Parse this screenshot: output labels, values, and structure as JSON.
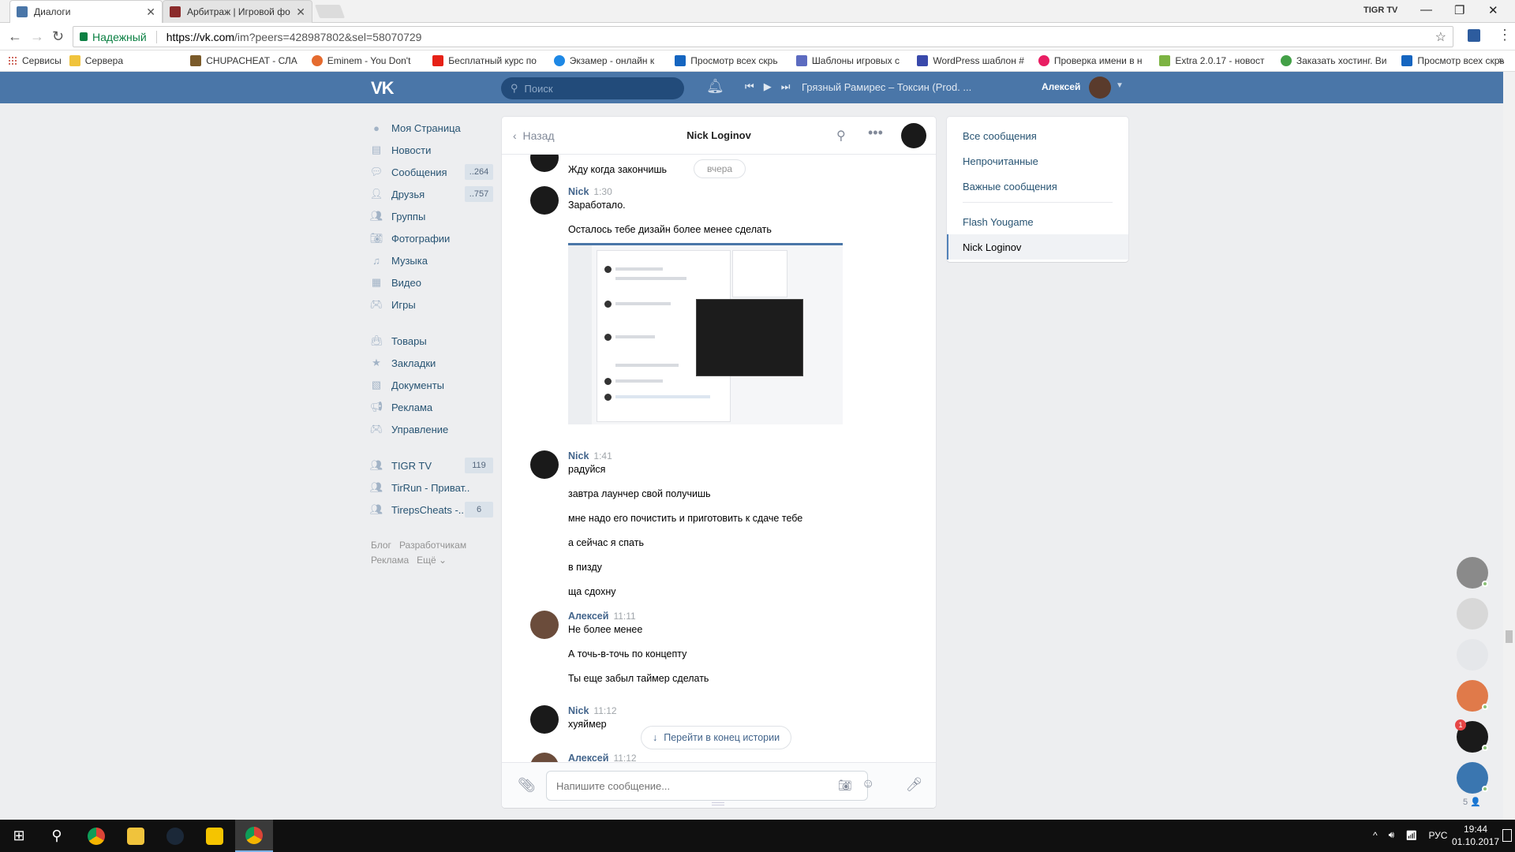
{
  "browser": {
    "tabs": [
      {
        "title": "Диалоги",
        "active": true
      },
      {
        "title": "Арбитраж | Игровой фо",
        "active": false
      }
    ],
    "profile_name": "TIGR TV",
    "secure_label": "Надежный",
    "url_host": "https://vk.com",
    "url_path": "/im?peers=428987802&sel=58070729",
    "apps_label": "Сервисы",
    "bookmarks": [
      "Сервера",
      "CHUPACHEAT - СЛА",
      "Eminem - You Don't",
      "Бесплатный курс по",
      "Экзамер - онлайн к",
      "Просмотр всех скрь",
      "Шаблоны игровых с",
      "WordPress шаблон #",
      "Проверка имени в н",
      "Extra 2.0.17 - новост",
      "Заказать хостинг. Ви",
      "Просмотр всех скрь"
    ]
  },
  "vk_header": {
    "logo": "VK",
    "search_placeholder": "Поиск",
    "track": "Грязный Рамирес – Токсин (Prod. ...",
    "user_name": "Алексей"
  },
  "left_menu": {
    "items": [
      {
        "label": "Моя Страница",
        "icon": "user-icon",
        "count": ""
      },
      {
        "label": "Новости",
        "icon": "news-icon",
        "count": ""
      },
      {
        "label": "Сообщения",
        "icon": "chat-icon",
        "count": "..264"
      },
      {
        "label": "Друзья",
        "icon": "friends-icon",
        "count": "..757"
      },
      {
        "label": "Группы",
        "icon": "groups-icon",
        "count": ""
      },
      {
        "label": "Фотографии",
        "icon": "camera-icon",
        "count": ""
      },
      {
        "label": "Музыка",
        "icon": "music-icon",
        "count": ""
      },
      {
        "label": "Видео",
        "icon": "video-icon",
        "count": ""
      },
      {
        "label": "Игры",
        "icon": "gamepad-icon",
        "count": ""
      }
    ],
    "items2": [
      {
        "label": "Товары",
        "icon": "bag-icon",
        "count": ""
      },
      {
        "label": "Закладки",
        "icon": "star-icon",
        "count": ""
      },
      {
        "label": "Документы",
        "icon": "document-icon",
        "count": ""
      },
      {
        "label": "Реклама",
        "icon": "megaphone-icon",
        "count": ""
      },
      {
        "label": "Управление",
        "icon": "gamepad-icon",
        "count": ""
      }
    ],
    "groups": [
      {
        "label": "TIGR TV",
        "icon": "group-icon",
        "count": "119"
      },
      {
        "label": "TirRun - Приват..",
        "icon": "group-icon",
        "count": ""
      },
      {
        "label": "TirepsCheats -..",
        "icon": "group-icon",
        "count": "6"
      }
    ],
    "footer": [
      "Блог",
      "Разработчикам",
      "Реклама",
      "Ещё ⌄"
    ]
  },
  "chat": {
    "back_label": "Назад",
    "title": "Nick Loginov",
    "date_separator": "вчера",
    "first_line": "Жду когда закончишь",
    "messages": [
      {
        "author": "Nick",
        "time": "1:30",
        "lines": [
          "Заработало.",
          "Осталось тебе дизайн более менее сделать"
        ]
      },
      {
        "author": "Nick",
        "time": "1:41",
        "lines": [
          "радуйся",
          "завтра лаунчер свой получишь",
          "мне надо его почистить и приготовить к сдаче тебе",
          "а сейчас я спать",
          "в пизду",
          "ща сдохну"
        ]
      },
      {
        "author": "Алексей",
        "time": "11:11",
        "lines": [
          "Не более менее",
          "А точь-в-точь по концепту",
          "Ты еще забыл таймер сделать"
        ]
      },
      {
        "author": "Nick",
        "time": "11:12",
        "lines": [
          "хуяймер"
        ]
      },
      {
        "author": "Алексей",
        "time": "11:12",
        "lines": []
      }
    ],
    "jump_label": "Перейти в конец истории",
    "input_placeholder": "Напишите сообщение..."
  },
  "filters": {
    "items": [
      "Все сообщения",
      "Непрочитанные",
      "Важные сообщения"
    ],
    "dialogs": [
      "Flash Yougame",
      "Nick Loginov"
    ]
  },
  "chatbar": {
    "count": "5 👤",
    "badge": "1"
  },
  "taskbar": {
    "lang": "РУС",
    "time": "19:44",
    "date": "01.10.2017"
  },
  "colors": {
    "vk_blue": "#4a76a8",
    "link": "#285473",
    "author": "#42648b"
  }
}
